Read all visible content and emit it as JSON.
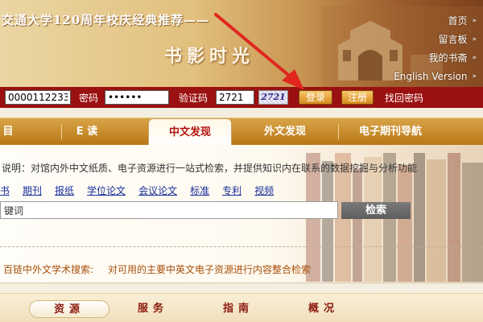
{
  "banner": {
    "title": "交通大学120周年校庆经典推荐——",
    "subtitle": "书影时光"
  },
  "top_links": [
    {
      "label": "首页",
      "icon": "double-chevron-right-icon"
    },
    {
      "label": "留言板",
      "icon": "double-chevron-right-icon"
    },
    {
      "label": "我的书斋",
      "icon": "double-chevron-right-icon"
    },
    {
      "label": "English Version",
      "icon": "double-chevron-right-icon"
    }
  ],
  "login": {
    "account_value": "0000112233",
    "password_label": "密码",
    "password_value": "••••••",
    "captcha_label": "验证码",
    "captcha_value": "2721",
    "captcha_image_text": "2721",
    "login_button": "登录",
    "register_button": "注册",
    "forgot_link": "找回密码"
  },
  "tabs": [
    {
      "label": "目"
    },
    {
      "label": "E 读"
    },
    {
      "label": "中文发现",
      "active": true
    },
    {
      "label": "外文发现"
    },
    {
      "label": "电子期刊导航"
    }
  ],
  "search": {
    "description": "说明：对馆内外中文纸质、电子资源进行一站式检索，并提供知识内在联系的数据挖掘与分析功能",
    "types": [
      "书",
      "期刊",
      "报纸",
      "学位论文",
      "会议论文",
      "标准",
      "专利",
      "视频"
    ],
    "input_value": "键词",
    "button_label": "检索",
    "engine_label": "百链中外文学术搜索:",
    "engine_desc": "对可用的主要中英文电子资源进行内容整合检索"
  },
  "bottom_nav": [
    {
      "label": "资源",
      "active": true
    },
    {
      "label": "服务"
    },
    {
      "label": "指南"
    },
    {
      "label": "概况"
    }
  ],
  "colors": {
    "login_bar": "#9b1010",
    "tab_bar": "#c98a2a",
    "active_tab_text": "#b3140f",
    "link": "#1a2f9a",
    "engine_text": "#a84f0a",
    "arrow": "#e0261f"
  }
}
